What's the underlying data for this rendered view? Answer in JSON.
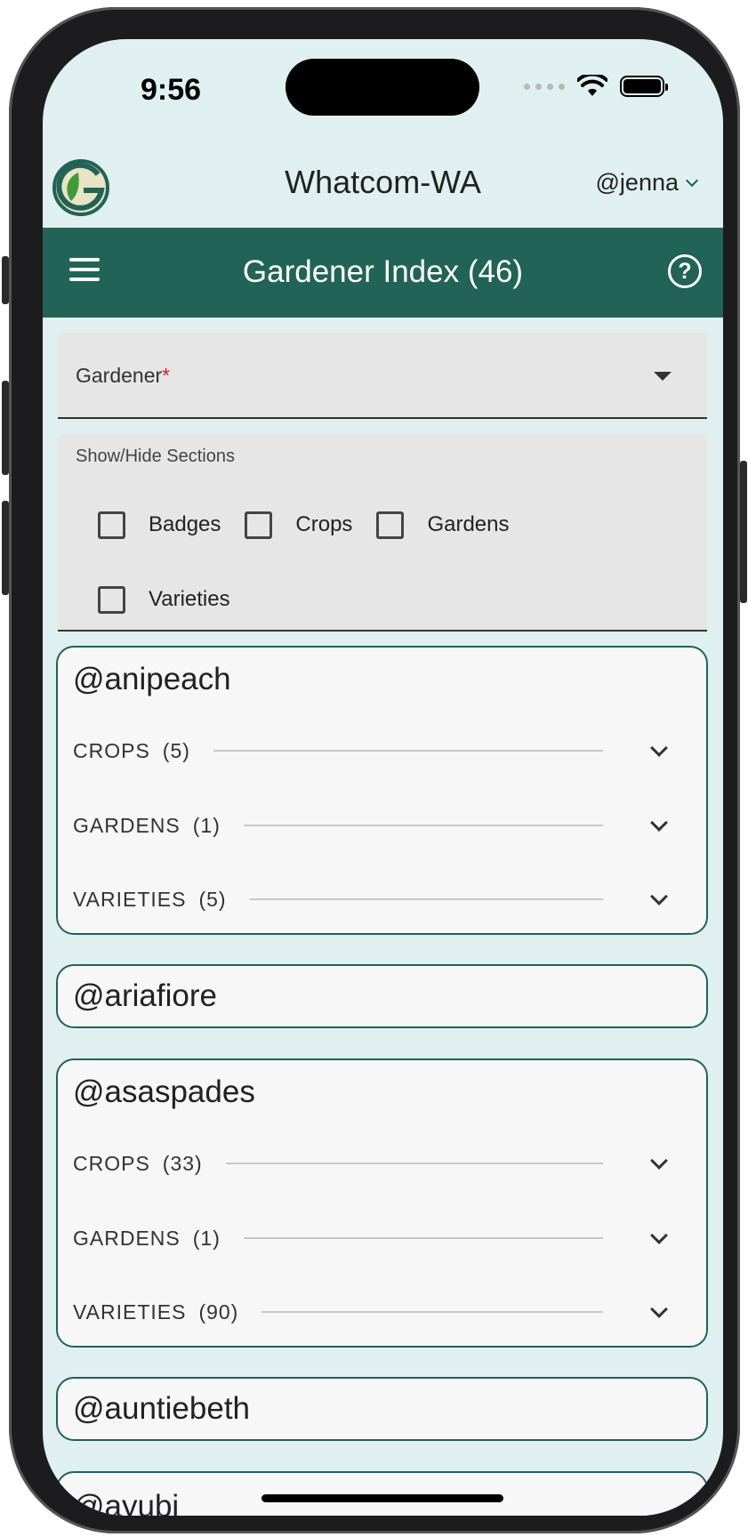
{
  "status": {
    "time": "9:56"
  },
  "header": {
    "region": "Whatcom-WA",
    "user": "@jenna"
  },
  "appbar": {
    "title": "Gardener Index (46)"
  },
  "filter": {
    "label": "Gardener",
    "required_mark": "*"
  },
  "sections_panel": {
    "label": "Show/Hide Sections",
    "options": [
      "Badges",
      "Crops",
      "Gardens",
      "Varieties"
    ]
  },
  "gardeners": [
    {
      "name": "@anipeach",
      "sections": [
        {
          "label": "CROPS",
          "count": "(5)"
        },
        {
          "label": "GARDENS",
          "count": "(1)"
        },
        {
          "label": "VARIETIES",
          "count": "(5)"
        }
      ]
    },
    {
      "name": "@ariafiore",
      "sections": []
    },
    {
      "name": "@asaspades",
      "sections": [
        {
          "label": "CROPS",
          "count": "(33)"
        },
        {
          "label": "GARDENS",
          "count": "(1)"
        },
        {
          "label": "VARIETIES",
          "count": "(90)"
        }
      ]
    },
    {
      "name": "@auntiebeth",
      "sections": []
    },
    {
      "name": "@ayubi",
      "sections": []
    }
  ],
  "colors": {
    "primary": "#216357",
    "background": "#e0f0f0"
  }
}
